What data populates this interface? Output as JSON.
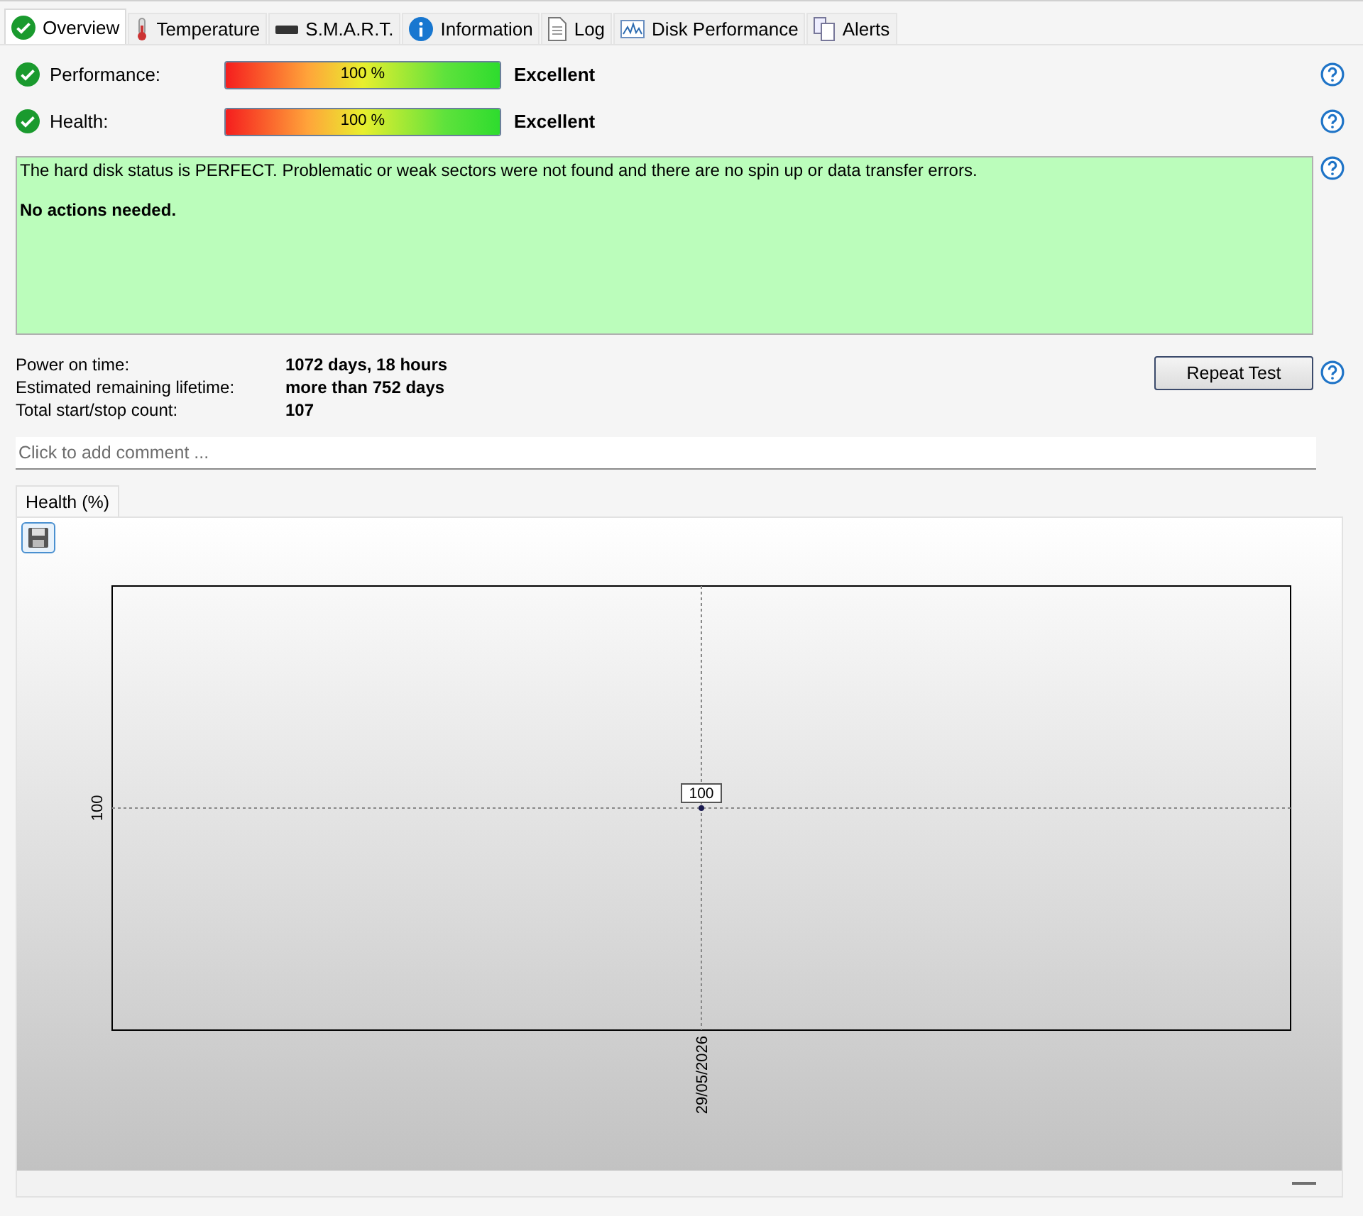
{
  "tabs": [
    {
      "label": "Overview",
      "kind": "check",
      "selected": true
    },
    {
      "label": "Temperature",
      "kind": "thermometer",
      "selected": false
    },
    {
      "label": "S.M.A.R.T.",
      "kind": "drive",
      "selected": false
    },
    {
      "label": "Information",
      "kind": "info",
      "selected": false
    },
    {
      "label": "Log",
      "kind": "document",
      "selected": false
    },
    {
      "label": "Disk Performance",
      "kind": "graph",
      "selected": false
    },
    {
      "label": "Alerts",
      "kind": "pages",
      "selected": false
    }
  ],
  "meters": [
    {
      "label": "Performance:",
      "level": 1,
      "reading": "100 %",
      "rating": "Excellent"
    },
    {
      "label": "Health:",
      "level": 1,
      "reading": "100 %",
      "rating": "Excellent"
    }
  ],
  "status": {
    "message": "The hard disk status is PERFECT. Problematic or weak sectors were not found and there are no spin up or data transfer errors.",
    "advice": "No actions needed."
  },
  "details": [
    {
      "label": "Power on time:",
      "value": "1072 days, 18 hours"
    },
    {
      "label": "Estimated remaining lifetime:",
      "value": "more than 752 days"
    },
    {
      "label": "Total start/stop count:",
      "value": "107"
    }
  ],
  "repeat_button": "Repeat Test",
  "comment": {
    "placeholder": "Click to add comment ..."
  },
  "chart_tabs": [
    {
      "label": "Health (%)",
      "selected": true
    }
  ],
  "chart": {
    "y_label": "100",
    "x_label": "29/05/2026",
    "point_label": "100"
  }
}
